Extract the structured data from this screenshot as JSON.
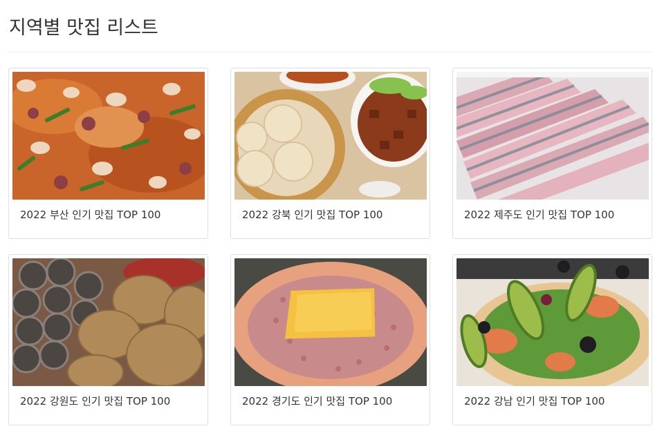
{
  "page": {
    "title": "지역별 맛집 리스트"
  },
  "cards": [
    {
      "caption": "2022 부산 인기 맛집 TOP 100",
      "image": "seafood-stew"
    },
    {
      "caption": "2022 강북 인기 맛집 TOP 100",
      "image": "dumplings"
    },
    {
      "caption": "2022 제주도 인기 맛집 TOP 100",
      "image": "raw-fish"
    },
    {
      "caption": "2022 강원도 인기 맛집 TOP 100",
      "image": "sundae-pancakes"
    },
    {
      "caption": "2022 경기도 인기 맛집 TOP 100",
      "image": "sausage-cheese"
    },
    {
      "caption": "2022 강남 인기 맛집 TOP 100",
      "image": "salad-pizza"
    }
  ]
}
